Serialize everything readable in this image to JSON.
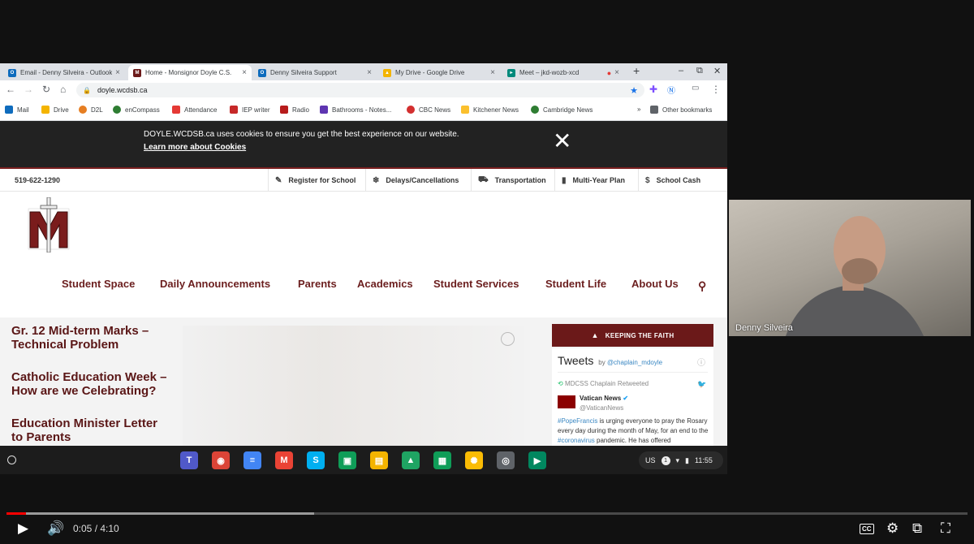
{
  "browser": {
    "tabs": [
      {
        "title": "Email - Denny Silveira - Outlook",
        "icon_color": "#0f6cbd",
        "icon": "outlook-icon",
        "active": false
      },
      {
        "title": "Home - Monsignor Doyle C.S.",
        "icon_color": "#6b1919",
        "icon": "school-logo-icon",
        "active": true
      },
      {
        "title": "Denny Silveira Support",
        "icon_color": "#0f6cbd",
        "icon": "outlook-icon",
        "active": false
      },
      {
        "title": "My Drive - Google Drive",
        "icon_color": "#f4b400",
        "icon": "drive-icon",
        "active": false
      },
      {
        "title": "Meet – jkd-wozb-xcd",
        "icon_color": "#00897b",
        "icon": "meet-icon",
        "active": false,
        "recording": true
      }
    ],
    "url": "doyle.wcdsb.ca",
    "bookmarks": [
      {
        "label": "Mail",
        "color": "#0f6cbd"
      },
      {
        "label": "Drive",
        "color": "#f4b400"
      },
      {
        "label": "D2L",
        "color": "#e67e22"
      },
      {
        "label": "enCompass",
        "color": "#2e7d32"
      },
      {
        "label": "Attendance",
        "color": "#e53935"
      },
      {
        "label": "IEP writer",
        "color": "#c62828"
      },
      {
        "label": "Radio",
        "color": "#b71c1c"
      },
      {
        "label": "Bathrooms - Notes...",
        "color": "#5e35b1"
      },
      {
        "label": "CBC News",
        "color": "#d32f2f"
      },
      {
        "label": "Kitchener News",
        "color": "#fbc02d"
      },
      {
        "label": "Cambridge News",
        "color": "#2e7d32"
      }
    ],
    "bookmarks_overflow": "»",
    "other_bookmarks": "Other bookmarks"
  },
  "site": {
    "cookie": {
      "message": "DOYLE.WCDSB.ca uses cookies to ensure you get the best experience on our website.",
      "learn_more": "Learn more about Cookies",
      "close": "✕"
    },
    "phone": "519-622-1290",
    "top_links": [
      {
        "label": "Register for School",
        "icon": "✎"
      },
      {
        "label": "Delays/Cancellations",
        "icon": "❄"
      },
      {
        "label": "Transportation",
        "icon": "🚘"
      },
      {
        "label": "Multi-Year Plan",
        "icon": "▮"
      },
      {
        "label": "School Cash",
        "icon": "$"
      }
    ],
    "main_nav": [
      "Student Space",
      "Daily Announcements",
      "Parents",
      "Academics",
      "Student Services",
      "Student Life",
      "About Us"
    ],
    "news": [
      [
        "Gr. 12 Mid-term Marks –",
        "Technical Problem"
      ],
      [
        "Catholic Education Week –",
        "How are we Celebrating?"
      ],
      [
        "Education Minister Letter",
        "to Parents"
      ]
    ],
    "faith_banner": "KEEPING THE FAITH",
    "tweets": {
      "heading": "Tweets",
      "by": "by",
      "handle": "@chaplain_mdoyle",
      "retweeted": "MDCSS Chaplain Retweeted",
      "user_name": "Vatican News",
      "user_handle": "@VaticanNews",
      "body_tag": "#PopeFrancis",
      "body_1": " is urging everyone to pray the Rosary every day during the month of May, for an end to the ",
      "body_tag2": "#coronavirus",
      "body_2": " pandemic. He has offered"
    }
  },
  "shelf": {
    "apps": [
      {
        "name": "teams-icon",
        "color": "#5059c9",
        "glyph": "T"
      },
      {
        "name": "chrome-icon",
        "color": "#db4437",
        "glyph": "◉"
      },
      {
        "name": "docs-icon",
        "color": "#4285f4",
        "glyph": "≡"
      },
      {
        "name": "gmail-icon",
        "color": "#ea4335",
        "glyph": "M"
      },
      {
        "name": "skype-icon",
        "color": "#00aff0",
        "glyph": "S"
      },
      {
        "name": "classroom-icon",
        "color": "#0f9d58",
        "glyph": "▣"
      },
      {
        "name": "keep-icon",
        "color": "#f4b400",
        "glyph": "▤"
      },
      {
        "name": "drive-icon",
        "color": "#1fa463",
        "glyph": "▲"
      },
      {
        "name": "sheets-icon",
        "color": "#0f9d58",
        "glyph": "▦"
      },
      {
        "name": "photos-icon",
        "color": "#fbbc04",
        "glyph": "✺"
      },
      {
        "name": "camera-icon",
        "color": "#5f6368",
        "glyph": "◎"
      },
      {
        "name": "play-store-icon",
        "color": "#01875f",
        "glyph": "▶"
      }
    ],
    "tray": {
      "locale": "US",
      "notifications": "1",
      "time": "11:55"
    }
  },
  "participant": {
    "name": "Denny Silveira"
  },
  "player": {
    "time_current": "0:05",
    "time_total": "4:10",
    "time_display": "0:05 / 4:10",
    "played_fraction": 0.02,
    "buffered_fraction": 0.32
  }
}
